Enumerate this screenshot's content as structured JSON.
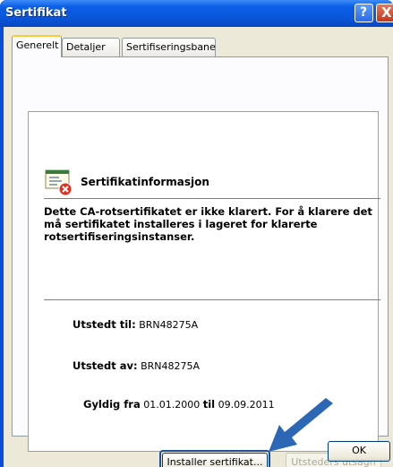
{
  "window": {
    "title": "Sertifikat",
    "help_glyph": "?",
    "close_glyph": "X"
  },
  "tabs": [
    {
      "label": "Generelt",
      "active": true
    },
    {
      "label": "Detaljer",
      "active": false
    },
    {
      "label": "Sertifiseringsbane",
      "active": false
    }
  ],
  "info": {
    "title": "Sertifikatinformasjon",
    "icon": "certificate-error-icon",
    "message": "Dette CA-rotsertifikatet er ikke klarert. For å klarere det må sertifikatet installeres i lageret for klarerte rotsertifiseringsinstanser."
  },
  "details": {
    "issued_to_label": "Utstedt til:",
    "issued_to_value": "BRN48275A",
    "issued_by_label": "Utstedt av:",
    "issued_by_value": "BRN48275A",
    "valid_from_label": "Gyldig fra",
    "valid_from_value": "01.01.2000",
    "valid_to_label": "til",
    "valid_to_value": "09.09.2011"
  },
  "buttons": {
    "install": "Installer sertifikat...",
    "issuer_statement": "Utsteders utsagn",
    "ok": "OK"
  },
  "colors": {
    "title_bar": "#0a55d8",
    "dialog_bg": "#ece9d8",
    "highlight_outline": "#1b4f9c",
    "arrow": "#2b67b5"
  }
}
